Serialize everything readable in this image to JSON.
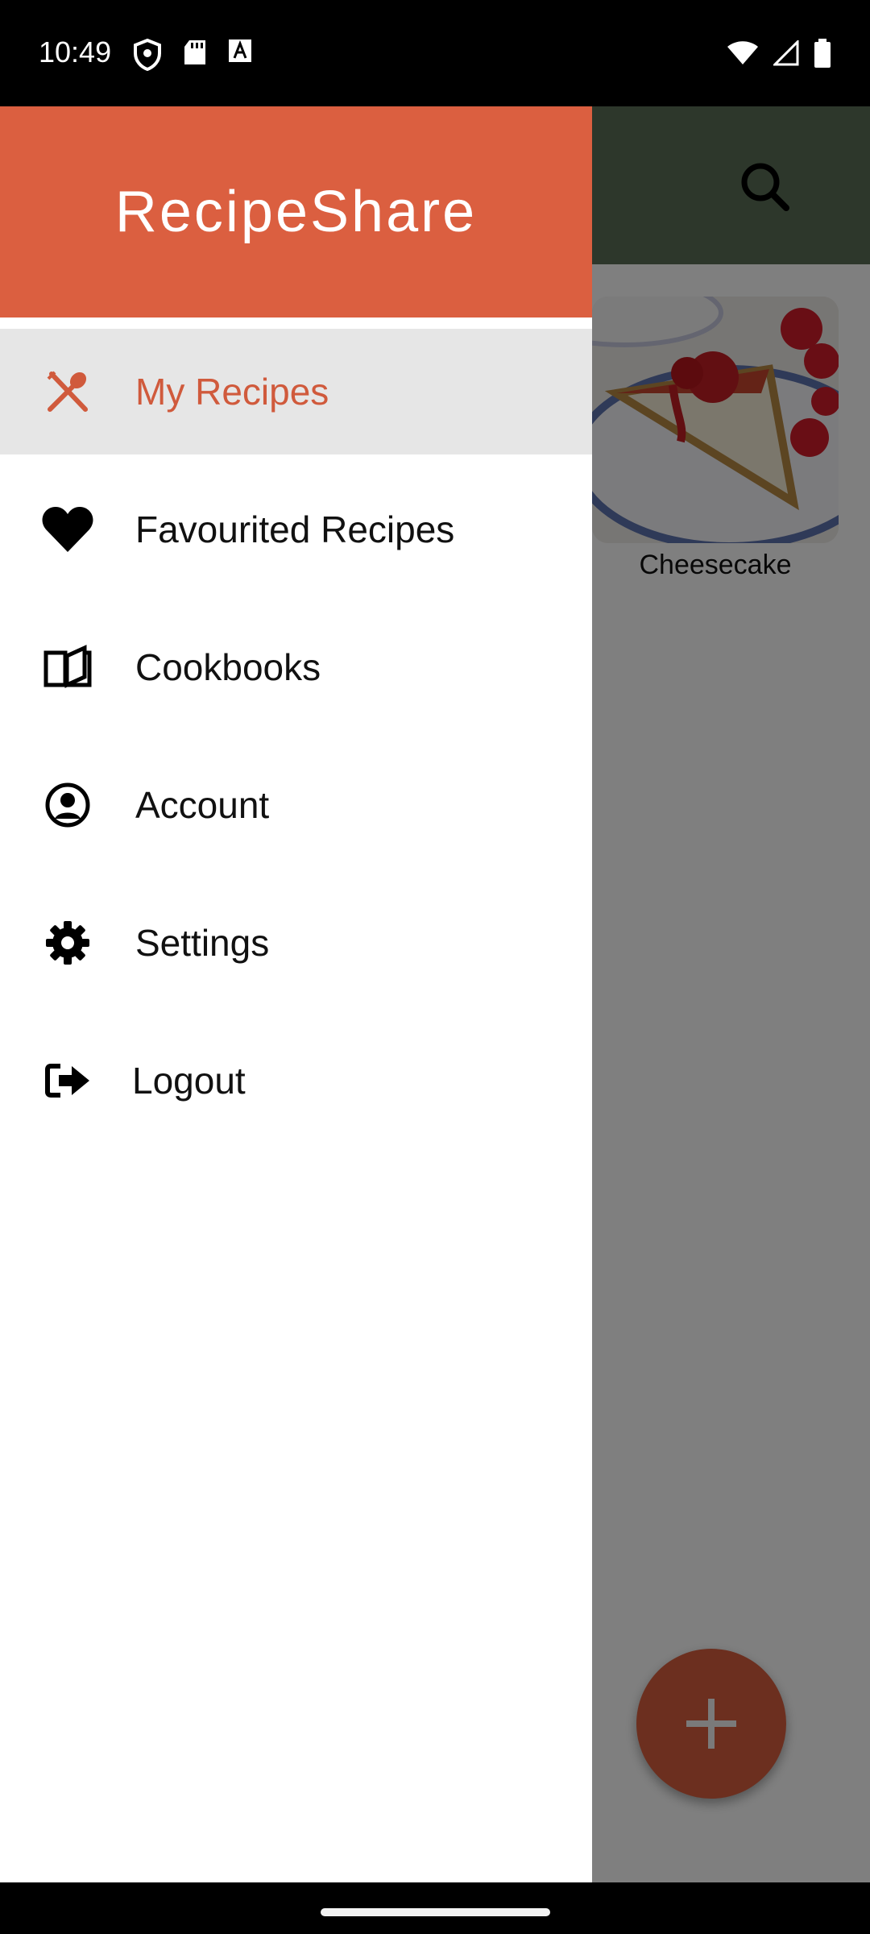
{
  "status_bar": {
    "time": "10:49",
    "left_icons": [
      "shield-icon",
      "sd-card-icon",
      "font-a-icon"
    ],
    "right_icons": [
      "wifi-icon",
      "signal-icon",
      "battery-icon"
    ]
  },
  "app": {
    "appbar_color": "#5a6e57",
    "search_icon": "search-icon",
    "recipes": [
      {
        "title": "Cheesecake"
      }
    ],
    "fab_icon": "plus-icon",
    "fab_color": "#d95f3f"
  },
  "drawer": {
    "title": "RecipeShare",
    "header_color": "#db5f40",
    "items": [
      {
        "label": "My Recipes",
        "icon": "fork-spoon-icon",
        "active": true
      },
      {
        "label": "Favourited Recipes",
        "icon": "heart-icon"
      },
      {
        "label": "Cookbooks",
        "icon": "open-book-icon"
      },
      {
        "label": "Account",
        "icon": "account-circle-icon"
      },
      {
        "label": "Settings",
        "icon": "gear-icon"
      },
      {
        "label": "Logout",
        "icon": "logout-icon"
      }
    ]
  }
}
